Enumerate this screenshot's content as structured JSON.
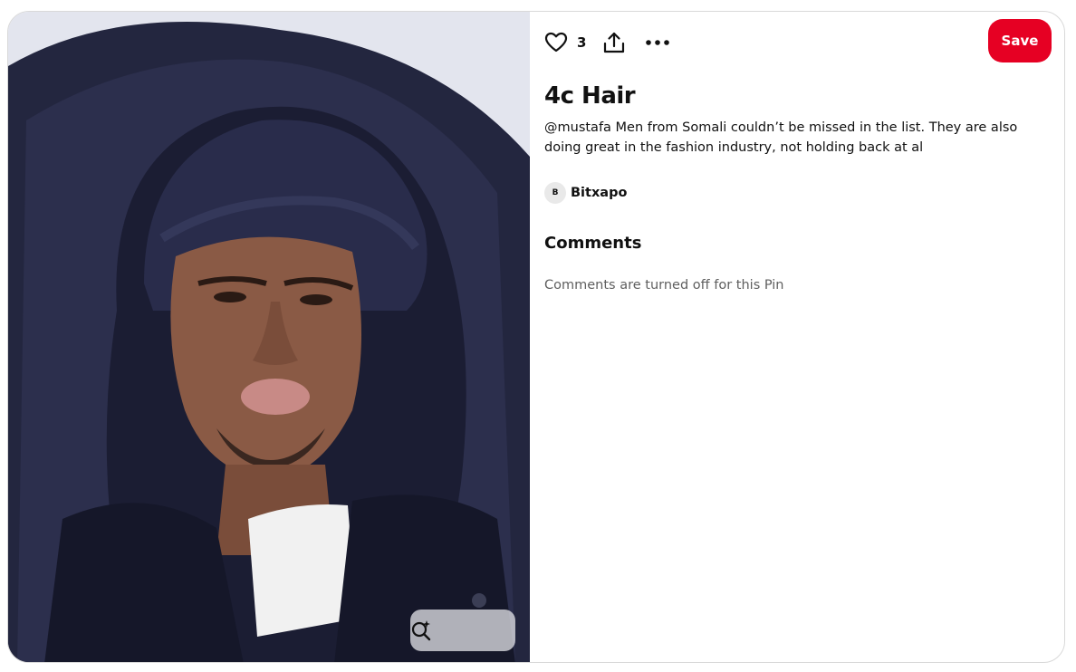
{
  "pin": {
    "image_alt": "",
    "title": "4c Hair",
    "description": "@mustafa Men from Somali couldn’t be missed in the list. They are also doing great in the fashion industry, not holding back at al",
    "like_count": "3",
    "save_label": "Save"
  },
  "creator": {
    "avatar_initial": "B",
    "name": "Bitxapo"
  },
  "comments": {
    "heading": "Comments",
    "status": "Comments are turned off for this Pin"
  },
  "icons": {
    "like": "heart-icon",
    "share": "share-icon",
    "more": "more-options-icon",
    "visual_search": "visual-search-icon"
  },
  "colors": {
    "save_button": "#e60023",
    "muted_text": "#5f5f5f"
  }
}
